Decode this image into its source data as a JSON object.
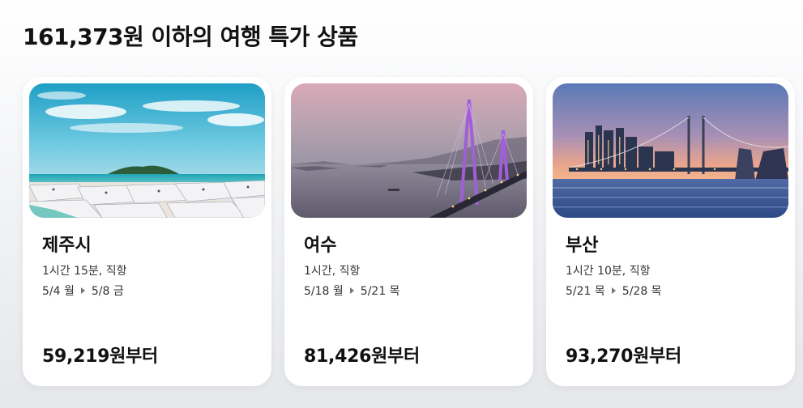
{
  "page": {
    "title": "161,373원 이하의 여행 특가 상품"
  },
  "deals": [
    {
      "city": "제주시",
      "duration": "1시간 15분, 직항",
      "depart": "5/4 월",
      "return": "5/8 금",
      "price": "59,219원부터",
      "image_icon": "jeju-beach-image"
    },
    {
      "city": "여수",
      "duration": "1시간, 직항",
      "depart": "5/18 월",
      "return": "5/21 목",
      "price": "81,426원부터",
      "image_icon": "yeosu-bridge-image"
    },
    {
      "city": "부산",
      "duration": "1시간 10분, 직항",
      "depart": "5/21 목",
      "return": "5/28 목",
      "price": "93,270원부터",
      "image_icon": "busan-bridge-image"
    }
  ],
  "colors": {
    "background": "#e9ebee",
    "card": "#ffffff",
    "text": "#111111",
    "muted": "#333333"
  }
}
